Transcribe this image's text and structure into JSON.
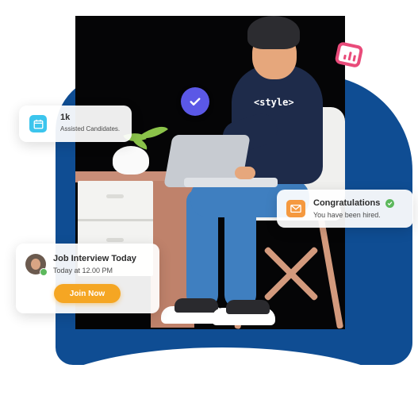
{
  "hero": {
    "hoodie_text": "<style>"
  },
  "cards": {
    "assisted": {
      "count": "1k",
      "label": "Assisted Candidates.",
      "icon": "calendar-icon"
    },
    "congrats": {
      "title": "Congratulations",
      "subtitle": "You have been hired.",
      "icon": "mail-icon",
      "badge_icon": "check-circle-icon"
    },
    "interview": {
      "title": "Job Interview Today",
      "time": "Today at 12.00 PM",
      "button_label": "Join Now"
    }
  },
  "colors": {
    "blue_background": "#0f4d93",
    "join_button": "#f5a623",
    "verified_badge": "#5b58e6",
    "chart_tile": "#e94b7a"
  }
}
